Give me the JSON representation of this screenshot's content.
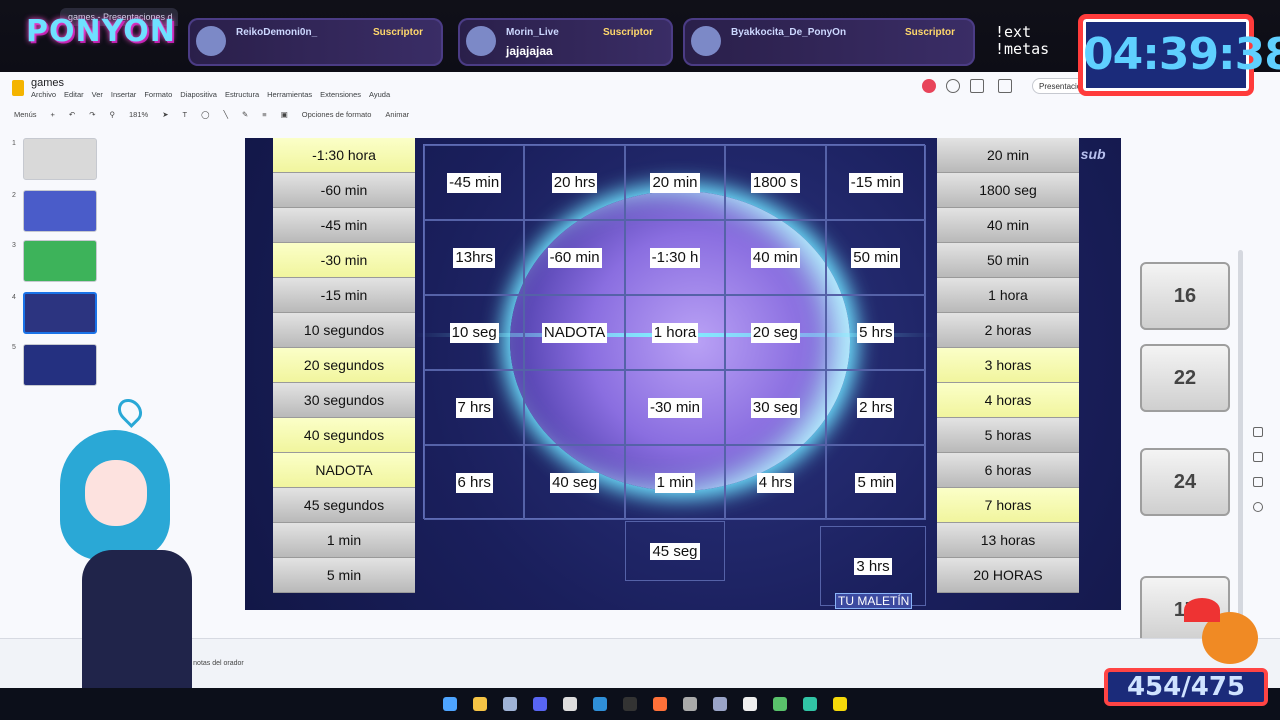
{
  "browser": {
    "tab_title": "games - Presentaciones d"
  },
  "overlay": {
    "logo": "PONYON",
    "timer": "04:39:38",
    "ext_commands": [
      "!ext",
      "!metas"
    ],
    "subs": [
      {
        "name": "ReikoDemoni0n_",
        "badge": "Suscriptor",
        "msg": ""
      },
      {
        "name": "Morin_Live",
        "badge": "Suscriptor",
        "msg": "jajajajaa"
      },
      {
        "name": "Byakkocita_De_PonyOn",
        "badge": "Suscriptor",
        "msg": ""
      }
    ],
    "goal": "454/475",
    "sub_watermark": "1 sub"
  },
  "app": {
    "title": "games",
    "menu": [
      "Archivo",
      "Editar",
      "Ver",
      "Insertar",
      "Formato",
      "Diapositiva",
      "Estructura",
      "Herramientas",
      "Extensiones",
      "Ayuda"
    ],
    "toolbar": {
      "menus": "Menús",
      "zoom": "181%",
      "format_options": "Opciones de formato",
      "animate": "Animar"
    },
    "present": "Presentación",
    "notes_hint": "ar notas del orador",
    "thumb_numbers": [
      "1",
      "2",
      "3",
      "4",
      "5"
    ]
  },
  "slide": {
    "left_list": [
      {
        "text": "-1:30 hora",
        "color": "yellow"
      },
      {
        "text": "-60 min",
        "color": "grey"
      },
      {
        "text": "-45 min",
        "color": "grey"
      },
      {
        "text": "-30 min",
        "color": "yellow"
      },
      {
        "text": "-15 min",
        "color": "grey"
      },
      {
        "text": "10 segundos",
        "color": "grey"
      },
      {
        "text": "20 segundos",
        "color": "yellow"
      },
      {
        "text": "30 segundos",
        "color": "grey"
      },
      {
        "text": "40 segundos",
        "color": "yellow"
      },
      {
        "text": "NADOTA",
        "color": "yellow"
      },
      {
        "text": "45 segundos",
        "color": "grey"
      },
      {
        "text": "1 min",
        "color": "grey"
      },
      {
        "text": "5 min",
        "color": "grey"
      }
    ],
    "right_list": [
      {
        "text": "20 min",
        "color": "grey"
      },
      {
        "text": "1800 seg",
        "color": "grey"
      },
      {
        "text": "40 min",
        "color": "grey"
      },
      {
        "text": "50 min",
        "color": "grey"
      },
      {
        "text": "1 hora",
        "color": "grey"
      },
      {
        "text": "2 horas",
        "color": "grey"
      },
      {
        "text": "3 horas",
        "color": "yellow"
      },
      {
        "text": "4 horas",
        "color": "yellow"
      },
      {
        "text": "5 horas",
        "color": "grey"
      },
      {
        "text": "6 horas",
        "color": "grey"
      },
      {
        "text": "7 horas",
        "color": "yellow"
      },
      {
        "text": "13 horas",
        "color": "grey"
      },
      {
        "text": "20 HORAS",
        "color": "grey"
      }
    ],
    "grid": [
      [
        "-45 min",
        "20 hrs",
        "20 min",
        "1800 s",
        "-15 min"
      ],
      [
        "13hrs",
        "-60 min",
        "-1:30 h",
        "40 min",
        "50 min"
      ],
      [
        "10 seg",
        "NADOTA",
        "1 hora",
        "20 seg",
        "5 hrs"
      ],
      [
        "7 hrs",
        "",
        "-30 min",
        "30 seg",
        "2 hrs"
      ],
      [
        "6 hrs",
        "40 seg",
        "1 min",
        "4 hrs",
        "5 min"
      ]
    ],
    "extra_45": "45 seg",
    "extra_3h": "3 hrs",
    "maletin": "TU MALETÍN"
  },
  "briefcases": [
    "16",
    "22",
    "24",
    "17"
  ],
  "colors": {
    "accent": "#1a73e8",
    "slide_bg": "#1a1f5c",
    "yellow_cell": "#f1f59e",
    "grey_cell": "#c9c9c9"
  }
}
